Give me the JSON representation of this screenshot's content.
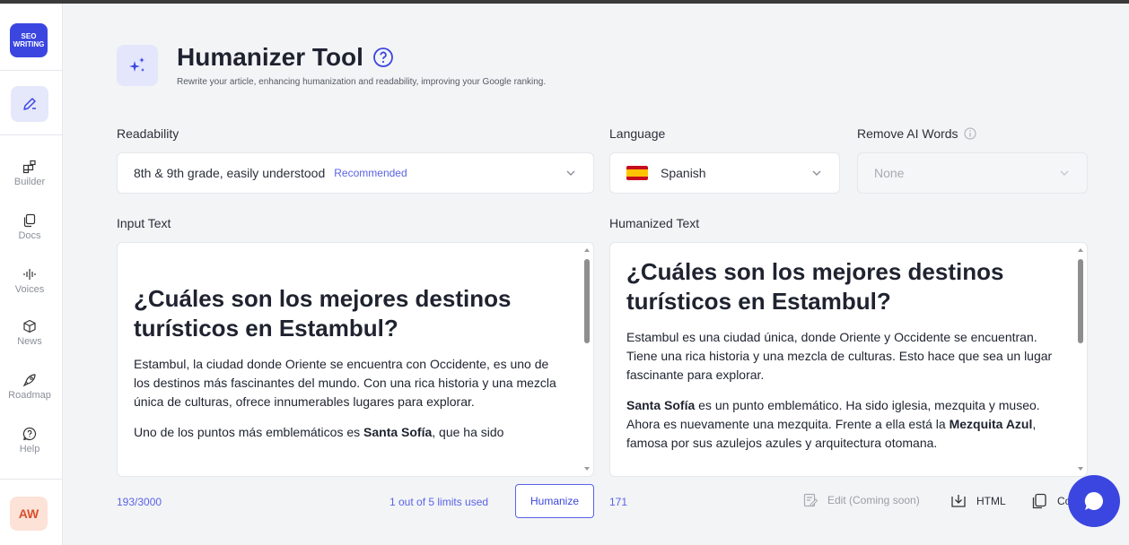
{
  "sidebar": {
    "logo_text": "SEO WRITING",
    "items": [
      {
        "label": "Builder",
        "icon": "builder-icon"
      },
      {
        "label": "Docs",
        "icon": "docs-icon"
      },
      {
        "label": "Voices",
        "icon": "voices-icon"
      },
      {
        "label": "News",
        "icon": "news-icon"
      },
      {
        "label": "Roadmap",
        "icon": "rocket-icon"
      },
      {
        "label": "Help",
        "icon": "help-icon"
      }
    ],
    "avatar_initials": "AW"
  },
  "header": {
    "title": "Humanizer Tool",
    "subtitle": "Rewrite your article, enhancing humanization and readability, improving your Google ranking."
  },
  "readability": {
    "label": "Readability",
    "value": "8th & 9th grade, easily understood",
    "badge": "Recommended"
  },
  "language": {
    "label": "Language",
    "value": "Spanish"
  },
  "remove_ai": {
    "label": "Remove AI Words",
    "value": "None"
  },
  "input": {
    "label": "Input Text",
    "heading": "¿Cuáles son los mejores destinos turísticos en Estambul?",
    "p1": "Estambul, la ciudad donde Oriente se encuentra con Occidente, es uno de los destinos más fascinantes del mundo. Con una rica historia y una mezcla única de culturas, ofrece innumerables lugares para explorar.",
    "p2_pre": "Uno de los puntos más emblemáticos es ",
    "p2_bold": "Santa Sofía",
    "p2_post": ", que ha sido",
    "count": "193/3000",
    "limits": "1 out of 5 limits used",
    "button": "Humanize"
  },
  "output": {
    "label": "Humanized Text",
    "heading": "¿Cuáles son los mejores destinos turísticos en Estambul?",
    "p1": "Estambul es una ciudad única, donde Oriente y Occidente se encuentran. Tiene una rica historia y una mezcla de culturas. Esto hace que sea un lugar fascinante para explorar.",
    "p2_bold": "Santa Sofía",
    "p2_mid": " es un punto emblemático. Ha sido iglesia, mezquita y museo. Ahora es nuevamente una mezquita. Frente a ella está la ",
    "p2_bold2": "Mezquita Azul",
    "p2_post": ", famosa por sus azulejos azules y arquitectura otomana.",
    "count": "171",
    "edit": "Edit (Coming soon)",
    "html": "HTML",
    "copy": "Co"
  },
  "colors": {
    "accent": "#3b46e0",
    "accent_light": "#5a63e6"
  }
}
